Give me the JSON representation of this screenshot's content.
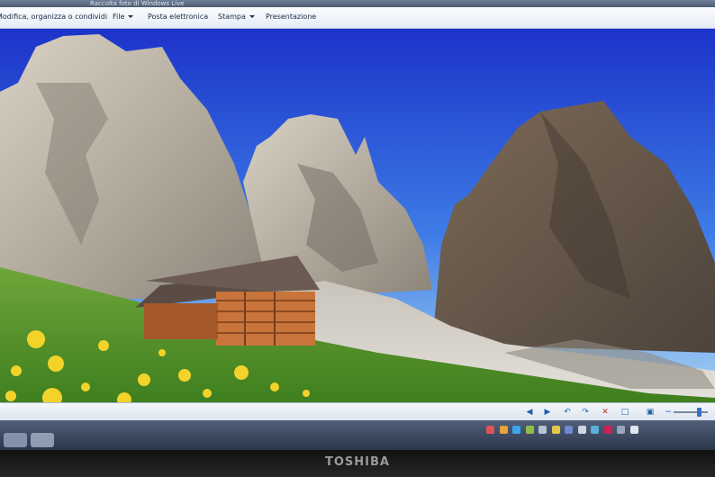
{
  "window": {
    "title": "Raccolta foto di Windows Live"
  },
  "menu": {
    "items": [
      {
        "label": "Modifica, organizza o condividi"
      },
      {
        "label": "File"
      },
      {
        "label": "Posta elettronica"
      },
      {
        "label": "Stampa"
      },
      {
        "label": "Presentazione"
      }
    ]
  },
  "photo": {
    "subject": "mountain-meadow-cabin-photo"
  },
  "viewer_controls": {
    "icons": [
      "previous-icon",
      "next-icon",
      "rotate-left-icon",
      "rotate-right-icon",
      "delete-icon",
      "actual-size-icon",
      "fit-icon",
      "zoom-out-icon",
      "zoom-slider",
      "zoom-in-icon"
    ],
    "accent": "#1f5fb0"
  },
  "monitor": {
    "brand": "TOSHIBA"
  }
}
